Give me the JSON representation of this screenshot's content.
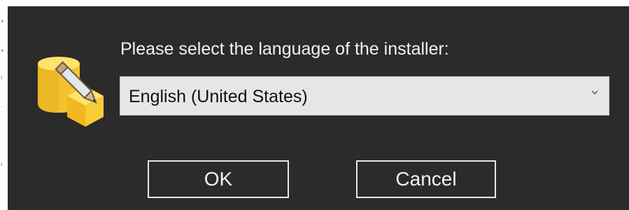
{
  "dialog": {
    "prompt": "Please select the language of the installer:",
    "language_select": {
      "selected": "English (United States)"
    },
    "buttons": {
      "ok_label": "OK",
      "cancel_label": "Cancel"
    },
    "icon": "installer-database-pencil-icon"
  },
  "colors": {
    "dialog_background": "#2b2b2b",
    "select_background": "#e6e6e6",
    "text": "#f2f2f2",
    "button_border": "#e6e6e6"
  }
}
